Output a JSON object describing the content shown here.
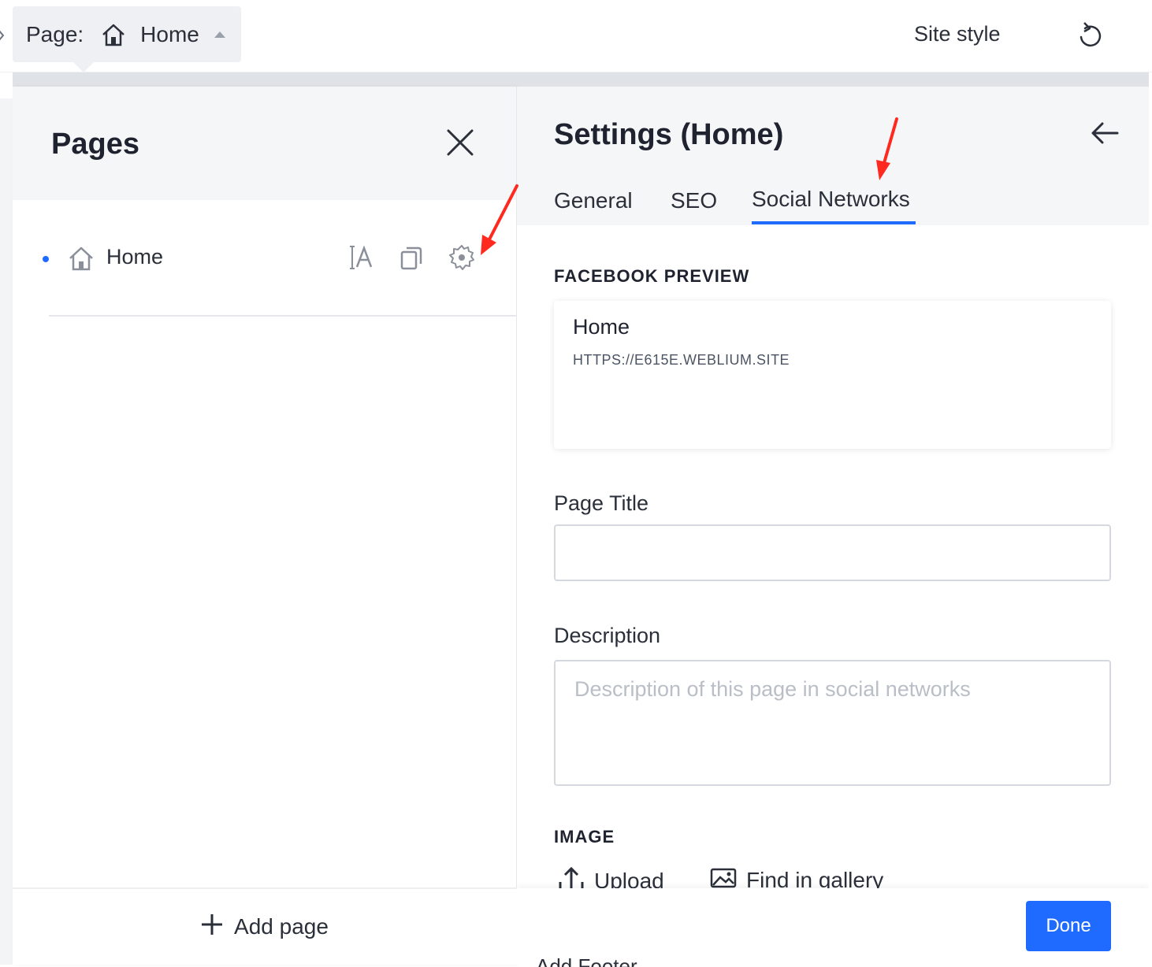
{
  "topbar": {
    "page_prefix": "Page:",
    "current_page": "Home",
    "site_style": "Site style"
  },
  "pages_panel": {
    "title": "Pages",
    "pages": [
      {
        "label": "Home"
      }
    ],
    "add_page": "Add page"
  },
  "settings": {
    "title": "Settings (Home)",
    "tabs": [
      "General",
      "SEO",
      "Social Networks"
    ],
    "active_tab": "Social Networks",
    "facebook_preview_label": "FACEBOOK PREVIEW",
    "preview": {
      "title": "Home",
      "url": "HTTPS://E615E.WEBLIUM.SITE"
    },
    "page_title_label": "Page Title",
    "page_title_value": "",
    "description_label": "Description",
    "description_placeholder": "Description of this page in social networks",
    "image_label": "IMAGE",
    "upload": "Upload",
    "find_in_gallery": "Find in gallery",
    "done": "Done"
  },
  "background": {
    "peek_text": "Add Footer"
  },
  "colors": {
    "accent": "#1f6bff",
    "annotation_arrow": "#ff2a1f",
    "header_bg": "#f5f6f8"
  }
}
